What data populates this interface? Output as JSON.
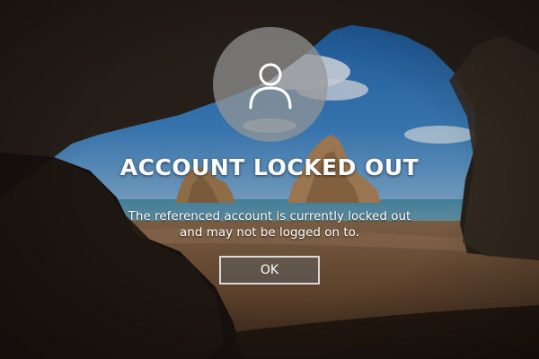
{
  "lock_screen": {
    "user_icon": "user-icon",
    "title": "ACCOUNT LOCKED OUT",
    "message_line1": "The referenced account is currently locked out",
    "message_line2": "and may not be logged on to.",
    "ok_button_label": "OK"
  },
  "colors": {
    "text": "#ffffff",
    "avatar_background": "#969696",
    "button_border": "#d9d9d9"
  }
}
